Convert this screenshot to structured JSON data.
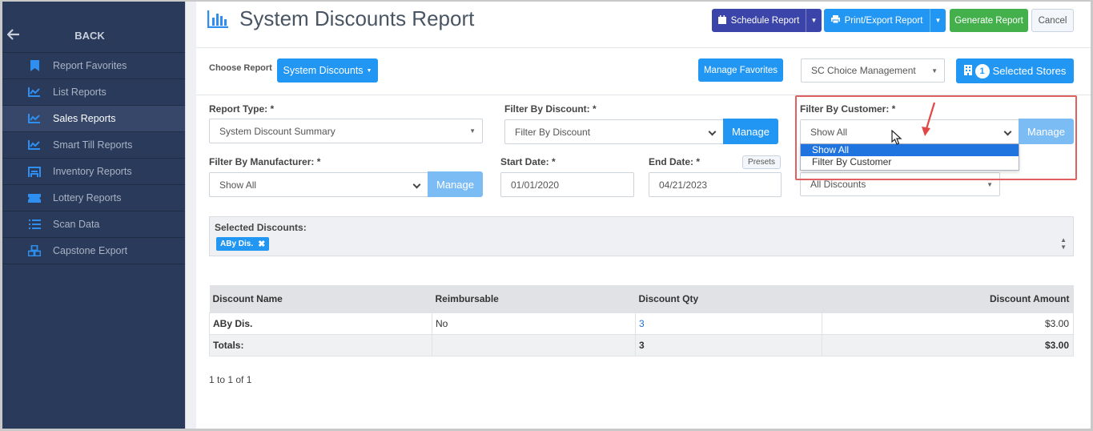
{
  "sidebar": {
    "back_label": "BACK",
    "items": [
      {
        "label": "Report Favorites",
        "icon": "bookmark-icon"
      },
      {
        "label": "List Reports",
        "icon": "chart-line-icon"
      },
      {
        "label": "Sales Reports",
        "icon": "chart-line-icon",
        "active": true
      },
      {
        "label": "Smart Till Reports",
        "icon": "chart-line-icon"
      },
      {
        "label": "Inventory Reports",
        "icon": "warehouse-icon"
      },
      {
        "label": "Lottery Reports",
        "icon": "ticket-icon"
      },
      {
        "label": "Scan Data",
        "icon": "list-icon"
      },
      {
        "label": "Capstone Export",
        "icon": "cubes-icon"
      }
    ]
  },
  "header": {
    "title": "System Discounts Report",
    "schedule": "Schedule Report",
    "print": "Print/Export Report",
    "generate": "Generate Report",
    "cancel": "Cancel"
  },
  "toolbar": {
    "choose_label": "Choose Report",
    "report_button": "System Discounts",
    "manage_favorites": "Manage Favorites",
    "company": "SC Choice Management",
    "stores_count": "1",
    "stores_label": "Selected Stores"
  },
  "filters": {
    "report_type_label": "Report Type: *",
    "report_type_value": "System Discount Summary",
    "discount_label": "Filter By Discount: *",
    "discount_value": "Filter By Discount",
    "manage": "Manage",
    "customer_label": "Filter By Customer: *",
    "customer_value": "Show All",
    "customer_options": [
      "Show All",
      "Filter By Customer"
    ],
    "manufacturer_label": "Filter By Manufacturer: *",
    "manufacturer_value": "Show All",
    "start_label": "Start Date: *",
    "start_value": "01/01/2020",
    "end_label": "End Date: *",
    "end_value": "04/21/2023",
    "presets": "Presets",
    "all_discounts": "All Discounts"
  },
  "selected": {
    "label": "Selected Discounts:",
    "chip": "ABy Dis."
  },
  "table": {
    "headers": [
      "Discount Name",
      "Reimbursable",
      "Discount Qty",
      "Discount Amount"
    ],
    "row": [
      "ABy Dis.",
      "No",
      "3",
      "$3.00"
    ],
    "totals": [
      "Totals:",
      "",
      "3",
      "$3.00"
    ]
  },
  "pager": "1 to 1 of 1",
  "colors": {
    "sidebar": "#2a3a5a",
    "accent": "#2196f3",
    "purple": "#3b44a8",
    "green": "#44b04c",
    "annotation": "#e06060"
  }
}
